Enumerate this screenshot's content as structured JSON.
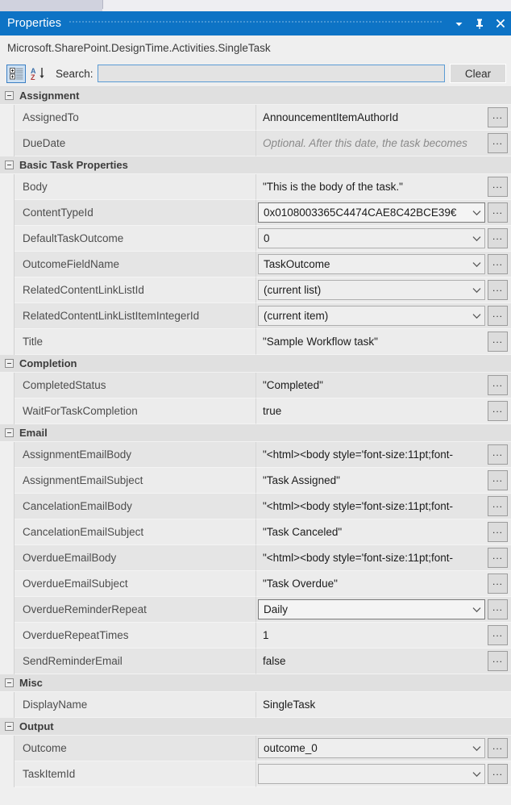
{
  "window": {
    "title": "Properties",
    "dropdown_icon": "chevron-down-icon",
    "pin_icon": "pin-icon",
    "close_icon": "close-icon"
  },
  "object_name": "Microsoft.SharePoint.DesignTime.Activities.SingleTask",
  "toolbar": {
    "categorized_icon": "categorized-view-icon",
    "alphabetical_icon": "alphabetical-sort-icon",
    "search_label": "Search:",
    "search_value": "",
    "search_placeholder": "",
    "clear_label": "Clear"
  },
  "categories": [
    {
      "name": "Assignment",
      "rows": [
        {
          "name": "AssignedTo",
          "value": "AnnouncementItemAuthorId",
          "editor": "text",
          "placeholder": false,
          "ellipsis": true
        },
        {
          "name": "DueDate",
          "value": "Optional. After this date, the task becomes",
          "editor": "text",
          "placeholder": true,
          "ellipsis": true
        }
      ]
    },
    {
      "name": "Basic Task Properties",
      "rows": [
        {
          "name": "Body",
          "value": "\"This is the body of the task.\"",
          "editor": "text",
          "placeholder": false,
          "ellipsis": true
        },
        {
          "name": "ContentTypeId",
          "value": "0x0108003365C4474CAE8C42BCE39€",
          "editor": "combo",
          "focused": true,
          "ellipsis": true
        },
        {
          "name": "DefaultTaskOutcome",
          "value": "0",
          "editor": "combo",
          "ellipsis": true
        },
        {
          "name": "OutcomeFieldName",
          "value": "TaskOutcome",
          "editor": "combo",
          "ellipsis": true
        },
        {
          "name": "RelatedContentLinkListId",
          "value": "(current list)",
          "editor": "combo",
          "ellipsis": true
        },
        {
          "name": "RelatedContentLinkListItemIntegerId",
          "value": "(current item)",
          "editor": "combo",
          "ellipsis": true
        },
        {
          "name": "Title",
          "value": "\"Sample Workflow task\"",
          "editor": "text",
          "placeholder": false,
          "ellipsis": true
        }
      ]
    },
    {
      "name": "Completion",
      "rows": [
        {
          "name": "CompletedStatus",
          "value": "\"Completed\"",
          "editor": "text",
          "placeholder": false,
          "ellipsis": true
        },
        {
          "name": "WaitForTaskCompletion",
          "value": "true",
          "editor": "text",
          "placeholder": false,
          "ellipsis": true
        }
      ]
    },
    {
      "name": "Email",
      "rows": [
        {
          "name": "AssignmentEmailBody",
          "value": "\"<html><body style='font-size:11pt;font-",
          "editor": "text",
          "placeholder": false,
          "ellipsis": true
        },
        {
          "name": "AssignmentEmailSubject",
          "value": "\"Task Assigned\"",
          "editor": "text",
          "placeholder": false,
          "ellipsis": true
        },
        {
          "name": "CancelationEmailBody",
          "value": "\"<html><body style='font-size:11pt;font-",
          "editor": "text",
          "placeholder": false,
          "ellipsis": true
        },
        {
          "name": "CancelationEmailSubject",
          "value": "\"Task Canceled\"",
          "editor": "text",
          "placeholder": false,
          "ellipsis": true
        },
        {
          "name": "OverdueEmailBody",
          "value": "\"<html><body style='font-size:11pt;font-",
          "editor": "text",
          "placeholder": false,
          "ellipsis": true
        },
        {
          "name": "OverdueEmailSubject",
          "value": "\"Task Overdue\"",
          "editor": "text",
          "placeholder": false,
          "ellipsis": true
        },
        {
          "name": "OverdueReminderRepeat",
          "value": "Daily",
          "editor": "combo",
          "focused": true,
          "ellipsis": true
        },
        {
          "name": "OverdueRepeatTimes",
          "value": "1",
          "editor": "text",
          "placeholder": false,
          "ellipsis": true
        },
        {
          "name": "SendReminderEmail",
          "value": "false",
          "editor": "text",
          "placeholder": false,
          "ellipsis": true
        }
      ]
    },
    {
      "name": "Misc",
      "rows": [
        {
          "name": "DisplayName",
          "value": "SingleTask",
          "editor": "text",
          "placeholder": false,
          "ellipsis": false
        }
      ]
    },
    {
      "name": "Output",
      "rows": [
        {
          "name": "Outcome",
          "value": "outcome_0",
          "editor": "combo",
          "ellipsis": true
        },
        {
          "name": "TaskItemId",
          "value": "",
          "editor": "combo",
          "ellipsis": true
        }
      ]
    }
  ]
}
